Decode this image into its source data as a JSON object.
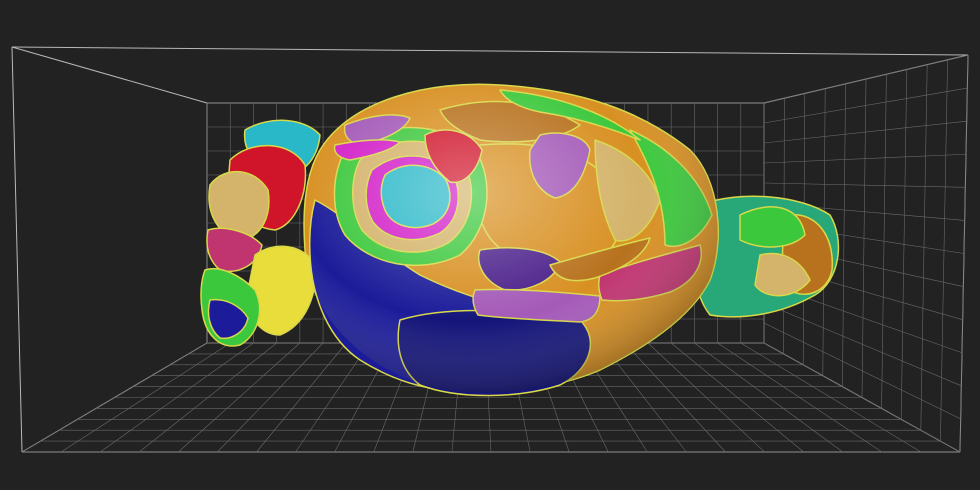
{
  "scene": {
    "background": "#222222",
    "box_color": "#b8b8b8",
    "grid_color": "#6a6a6a",
    "outline_color": "#d8d84a"
  },
  "palette": {
    "red": "#d0142a",
    "cyan": "#29b8c8",
    "tan": "#d4b36a",
    "yellow": "#e8dd3a",
    "blue": "#1c1c9a",
    "navy": "#14147a",
    "green": "#3cc83c",
    "magenta": "#d21ec8",
    "purple": "#a45ab8",
    "brown": "#b8721e",
    "orange": "#d89022",
    "teal": "#28a878",
    "pink": "#c03470",
    "violet": "#4a1e8a"
  }
}
